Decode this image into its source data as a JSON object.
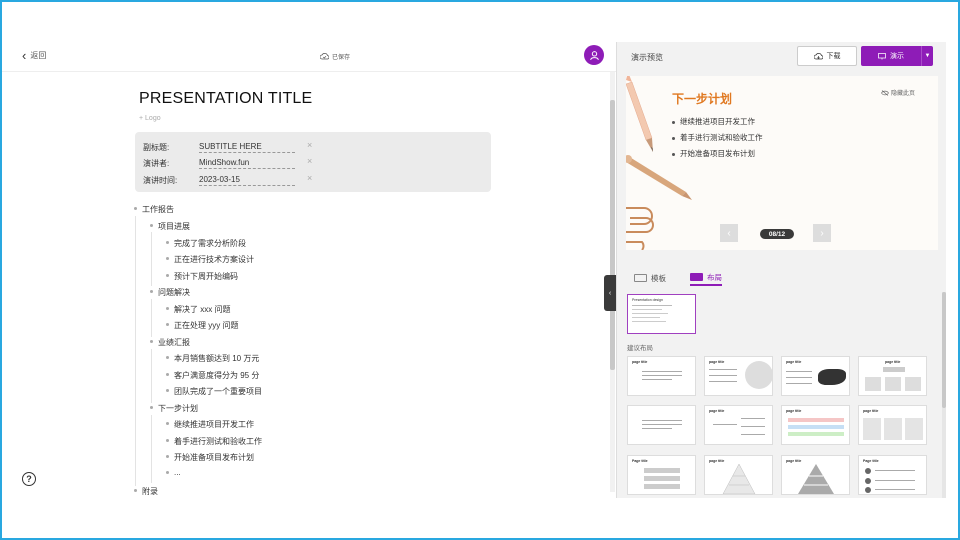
{
  "topbar": {
    "back_label": "返回",
    "saved_label": "已保存"
  },
  "document": {
    "title": "PRESENTATION TITLE",
    "logo_add": "+ Logo",
    "meta": [
      {
        "label": "副标题:",
        "value": "SUBTITLE HERE",
        "remove": "×"
      },
      {
        "label": "演讲者:",
        "value": "MindShow.fun",
        "remove": "×"
      },
      {
        "label": "演讲时间:",
        "value": "2023-03-15",
        "remove": "×"
      }
    ]
  },
  "outline": {
    "l0_1": "工作报告",
    "l1_1": "项目进展",
    "l2_1": "完成了需求分析阶段",
    "l2_2": "正在进行技术方案设计",
    "l2_3": "预计下周开始编码",
    "l1_2": "问题解决",
    "l2_4": "解决了 xxx 问题",
    "l2_5": "正在处理 yyy 问题",
    "l1_3": "业绩汇报",
    "l2_6": "本月销售额达到 10 万元",
    "l2_7": "客户满意度得分为 95 分",
    "l2_8": "团队完成了一个重要项目",
    "l1_4": "下一步计划",
    "l2_9": "继续推进项目开发工作",
    "l2_10": "着手进行测试和验收工作",
    "l2_11": "开始准备项目发布计划",
    "l2_12": "...",
    "l0_2": "附录"
  },
  "help": {
    "glyph": "?"
  },
  "panel": {
    "title": "演示预览",
    "download_label": "下载",
    "present_label": "演示",
    "slide": {
      "title": "下一步计划",
      "bullets": [
        "继续推进项目开发工作",
        "着手进行测试和验收工作",
        "开始准备项目发布计划"
      ],
      "hide_label": "隐藏此页",
      "page_indicator": "08/12",
      "prev": "‹",
      "next": "›"
    },
    "tabs": {
      "template": "模板",
      "layout": "布局"
    },
    "current_thumb_title": "Presentation design",
    "suggested_label": "建议布局",
    "layout_titles": {
      "t1": "page title",
      "t2": "page title",
      "t3": "page title",
      "t4": "page title",
      "t5": "page title",
      "t6": "page title",
      "t7": "page title",
      "t8": "page title",
      "t9": "Page title",
      "t10": "page title",
      "t11": "page title",
      "t12": "Page title"
    }
  },
  "colors": {
    "accent": "#8e1cb7",
    "slide_title": "#e07820",
    "frame": "#29a8e0"
  }
}
